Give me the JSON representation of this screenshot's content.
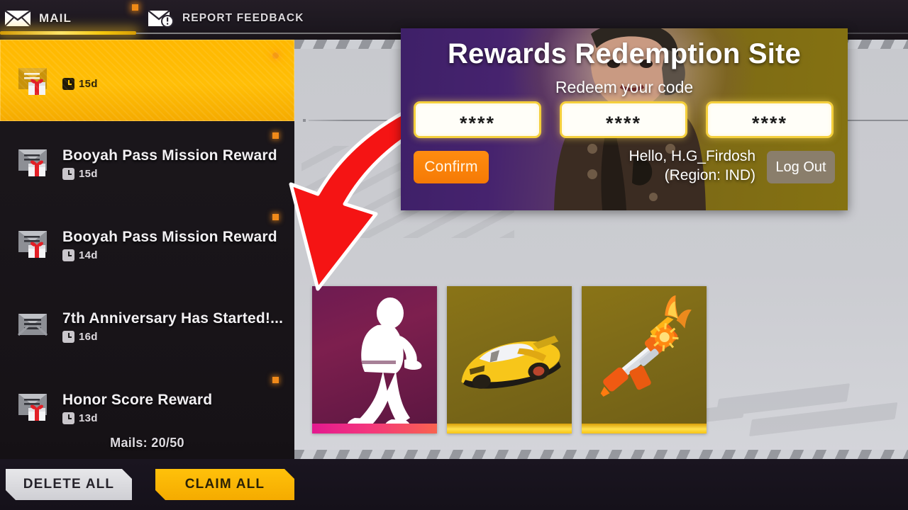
{
  "tabs": [
    {
      "id": "mail",
      "label": "MAIL",
      "icon": "envelope-icon",
      "active": true
    },
    {
      "id": "report_feedback",
      "label": "REPORT FEEDBACK",
      "icon": "envelope-alert-icon",
      "active": false
    }
  ],
  "mail_list": {
    "count_label": "Mails: 20/50",
    "items": [
      {
        "title": "",
        "days": "15d",
        "icon": "envelope-gift-icon",
        "selected": true,
        "badge": true
      },
      {
        "title": "Booyah Pass Mission Reward",
        "days": "15d",
        "icon": "envelope-gift-icon",
        "selected": false,
        "badge": true
      },
      {
        "title": "Booyah Pass Mission Reward",
        "days": "14d",
        "icon": "envelope-gift-icon",
        "selected": false,
        "badge": true
      },
      {
        "title": "7th Anniversary Has Started!...",
        "days": "16d",
        "icon": "envelope-icon",
        "selected": false,
        "badge": false
      },
      {
        "title": "Honor Score Reward",
        "days": "13d",
        "icon": "envelope-gift-icon",
        "selected": false,
        "badge": true
      }
    ]
  },
  "redemption_panel": {
    "title": "Rewards Redemption Site",
    "subtitle": "Redeem your code",
    "code_fields": [
      {
        "value": "****",
        "placeholder": "****"
      },
      {
        "value": "****",
        "placeholder": "****"
      },
      {
        "value": "****",
        "placeholder": "****"
      }
    ],
    "confirm_label": "Confirm",
    "greeting_line1": "Hello, H.G_Firdosh",
    "greeting_line2": "(Region: IND)",
    "logout_label": "Log Out"
  },
  "rewards": [
    {
      "name": "emote-reward",
      "type": "emote",
      "accent": "#e3198f"
    },
    {
      "name": "vehicle-reward",
      "type": "vehicle",
      "accent": "#ffe04d"
    },
    {
      "name": "weapon-reward",
      "type": "weapon",
      "accent": "#ffe04d"
    }
  ],
  "bottom_bar": {
    "delete_all_label": "DELETE ALL",
    "claim_all_label": "CLAIM ALL"
  },
  "colors": {
    "accent_yellow": "#ffb800",
    "accent_orange": "#f57a05",
    "arrow_red": "#f51414",
    "panel_purple": "#46236e",
    "panel_olive": "#7d6a16"
  }
}
